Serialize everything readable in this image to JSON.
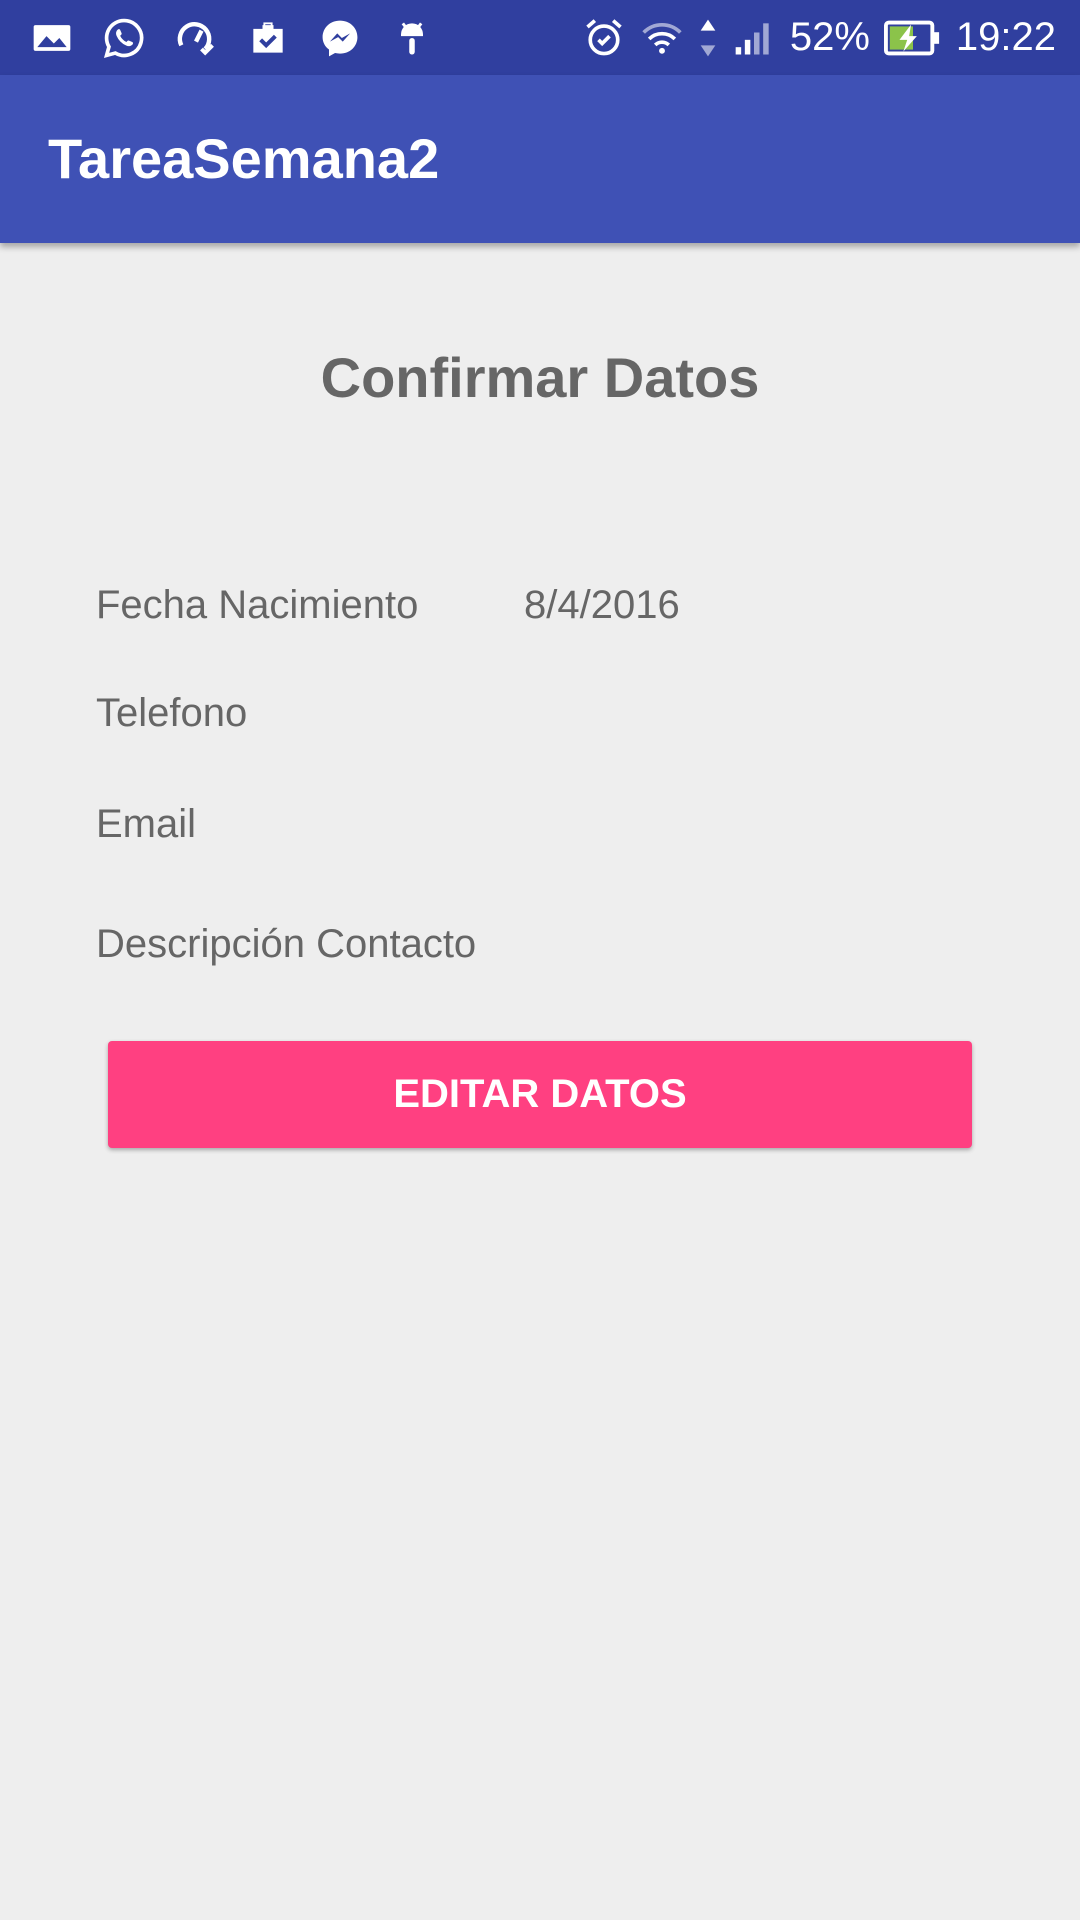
{
  "status_bar": {
    "notification_icons": [
      "gallery-icon",
      "whatsapp-icon",
      "speed-test-icon",
      "briefcase-check-icon",
      "messenger-icon",
      "android-debug-icon"
    ],
    "system_icons": [
      "alarm-icon",
      "wifi-icon",
      "signal-icon",
      "battery-charging-icon"
    ],
    "battery_percent": "52%",
    "time": "19:22"
  },
  "app_bar": {
    "title": "TareaSemana2"
  },
  "screen": {
    "title": "Confirmar Datos",
    "fields": [
      {
        "label": "Fecha Nacimiento",
        "value": "8/4/2016"
      },
      {
        "label": "Telefono",
        "value": ""
      },
      {
        "label": "Email",
        "value": ""
      },
      {
        "label": "Descripción Contacto",
        "value": ""
      }
    ],
    "edit_button_label": "EDITAR DATOS"
  },
  "colors": {
    "status_bar": "#303f9f",
    "app_bar": "#3f51b5",
    "accent": "#ff4081",
    "background": "#eeeeee",
    "text": "#666666"
  }
}
